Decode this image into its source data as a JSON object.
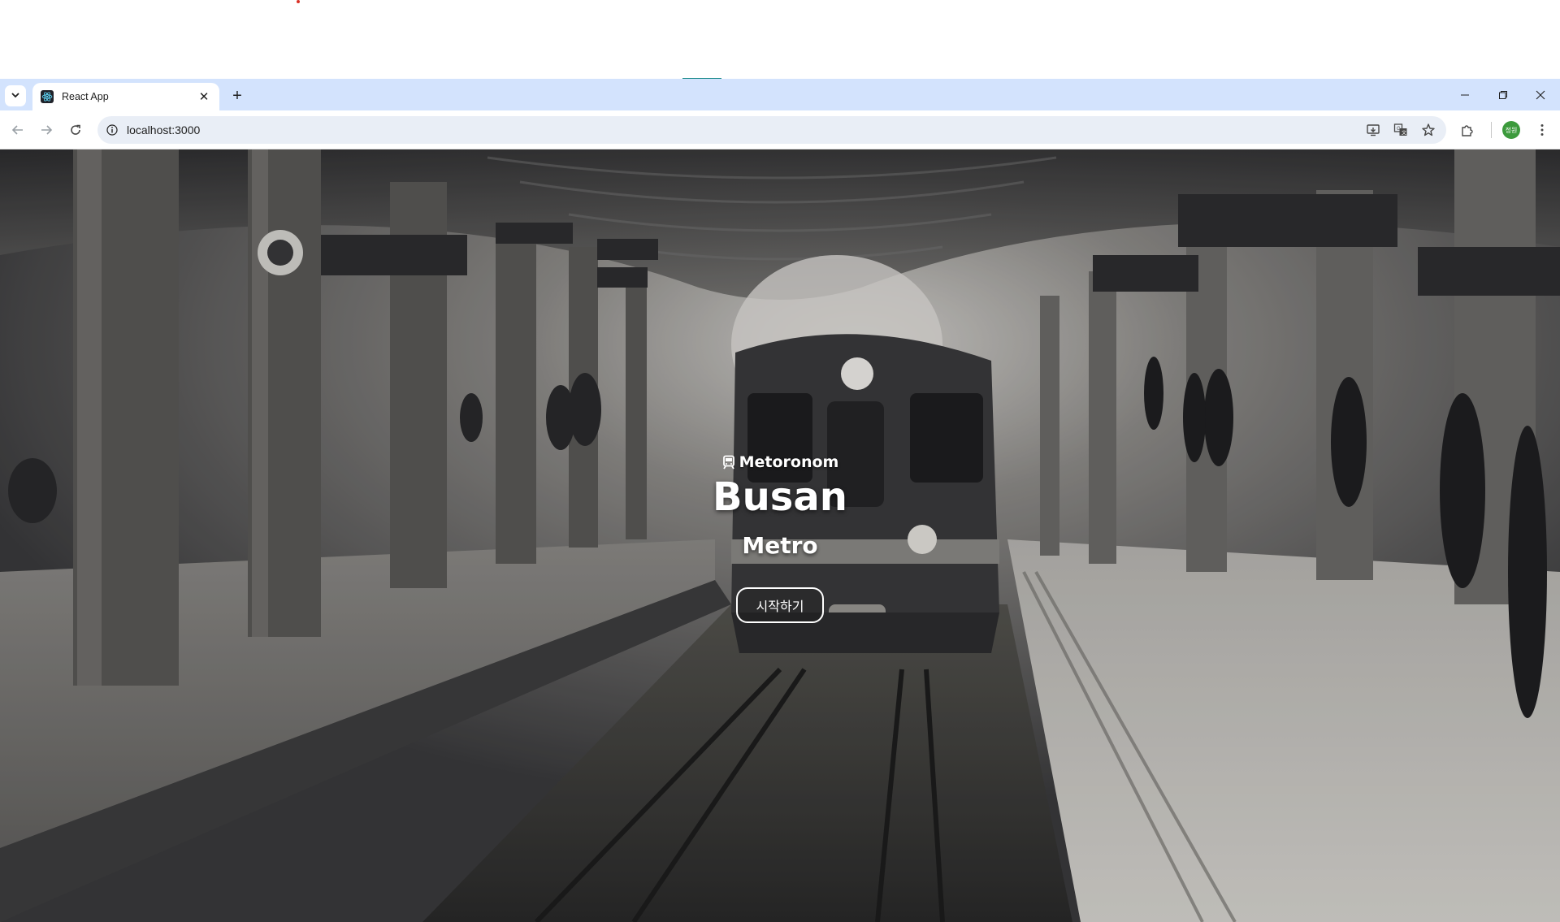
{
  "browser": {
    "tab": {
      "title": "React App",
      "favicon": "react-icon",
      "close_icon": "close-icon"
    },
    "new_tab_icon": "plus-icon",
    "tab_search_icon": "chevron-down-icon",
    "window_controls": [
      "minimize-icon",
      "restore-icon",
      "close-icon"
    ],
    "address": {
      "url": "localhost:3000",
      "info_icon": "info-icon"
    },
    "nav_icons": [
      "back-icon",
      "forward-icon",
      "reload-icon"
    ],
    "toolbar_icons": [
      "install-app-icon",
      "translate-icon",
      "bookmark-star-icon",
      "extensions-icon"
    ],
    "profile": {
      "label": "정원",
      "color": "#3c9a3c"
    },
    "accent": "#d3e3fd"
  },
  "hero": {
    "brand": "Metoronom",
    "brand_icon": "train-icon",
    "title": "Busan",
    "subtitle": "Metro",
    "start_button": "시작하기",
    "background": "subway-station-photo"
  }
}
